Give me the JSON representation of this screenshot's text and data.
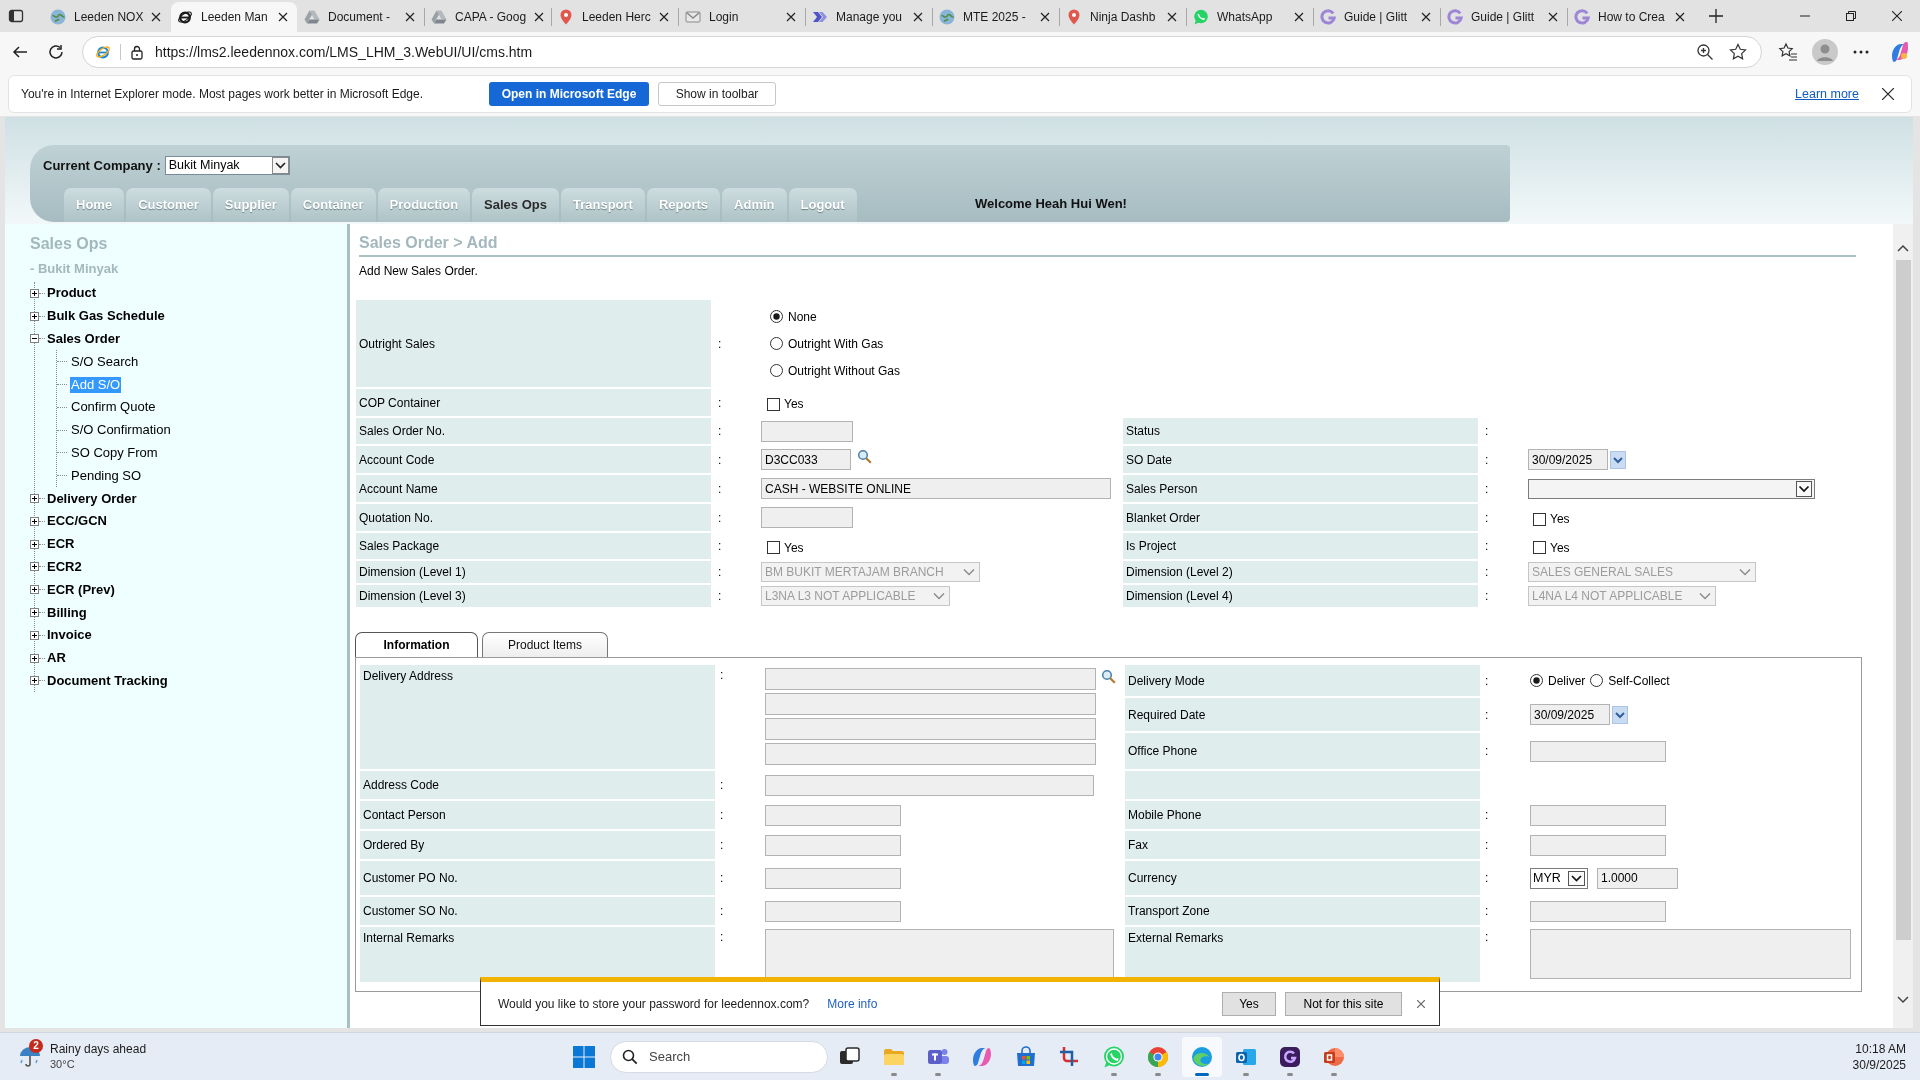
{
  "browser": {
    "tabs": [
      {
        "title": "Leeden NOX",
        "kind": "globe",
        "selected": false
      },
      {
        "title": "Leeden Man",
        "kind": "ie",
        "selected": true
      },
      {
        "title": "Document -",
        "kind": "drive",
        "selected": false
      },
      {
        "title": "CAPA - Goog",
        "kind": "drive",
        "selected": false
      },
      {
        "title": "Leeden Herc",
        "kind": "pin",
        "selected": false
      },
      {
        "title": "Login",
        "kind": "mail",
        "selected": false
      },
      {
        "title": "Manage you",
        "kind": "chevron",
        "selected": false
      },
      {
        "title": "MTE 2025 -",
        "kind": "globe",
        "selected": false
      },
      {
        "title": "Ninja Dashb",
        "kind": "pin",
        "selected": false
      },
      {
        "title": "WhatsApp",
        "kind": "chat",
        "selected": false
      },
      {
        "title": "Guide | Glitt",
        "kind": "g",
        "selected": false
      },
      {
        "title": "Guide | Glitt",
        "kind": "g",
        "selected": false
      },
      {
        "title": "How to Crea",
        "kind": "g",
        "selected": false
      }
    ],
    "address": "https://lms2.leedennox.com/LMS_LHM_3.WebUI/UI/cms.htm"
  },
  "ie_banner": {
    "message": "You're in Internet Explorer mode. Most pages work better in Microsoft Edge.",
    "primary_button": "Open in Microsoft Edge",
    "secondary_button": "Show in toolbar",
    "link": "Learn more"
  },
  "header": {
    "company_label": "Current Company :",
    "company": "Bukit Minyak",
    "nav": [
      {
        "label": "Home",
        "selected": false
      },
      {
        "label": "Customer",
        "selected": false
      },
      {
        "label": "Supplier",
        "selected": false
      },
      {
        "label": "Container",
        "selected": false
      },
      {
        "label": "Production",
        "selected": false
      },
      {
        "label": "Sales Ops",
        "selected": true
      },
      {
        "label": "Transport",
        "selected": false
      },
      {
        "label": "Reports",
        "selected": false
      },
      {
        "label": "Admin",
        "selected": false
      },
      {
        "label": "Logout",
        "selected": false
      }
    ],
    "welcome": "Welcome Heah Hui Wen!"
  },
  "sidebar": {
    "title": "Sales Ops",
    "subtitle": "- Bukit Minyak",
    "items": [
      {
        "label": "Product",
        "expanded": false
      },
      {
        "label": "Bulk Gas Schedule",
        "expanded": false
      },
      {
        "label": "Sales Order",
        "expanded": true,
        "children": [
          {
            "label": "S/O Search",
            "selected": false
          },
          {
            "label": "Add S/O",
            "selected": true
          },
          {
            "label": "Confirm Quote",
            "selected": false
          },
          {
            "label": "S/O Confirmation",
            "selected": false
          },
          {
            "label": "SO Copy From",
            "selected": false
          },
          {
            "label": "Pending SO",
            "selected": false
          }
        ]
      },
      {
        "label": "Delivery Order",
        "expanded": false
      },
      {
        "label": "ECC/GCN",
        "expanded": false
      },
      {
        "label": "ECR",
        "expanded": false
      },
      {
        "label": "ECR2",
        "expanded": false
      },
      {
        "label": "ECR (Prev)",
        "expanded": false
      },
      {
        "label": "Billing",
        "expanded": false
      },
      {
        "label": "Invoice",
        "expanded": false
      },
      {
        "label": "AR",
        "expanded": false
      },
      {
        "label": "Document Tracking",
        "expanded": false
      }
    ]
  },
  "form": {
    "title": "Sales Order > Add",
    "subtitle": "Add New Sales Order.",
    "rows": [
      {
        "left": {
          "label": "Outright Sales",
          "separator": ":",
          "kind": "radio",
          "options": [
            {
              "label": "None",
              "selected": true
            },
            {
              "label": "Outright With Gas",
              "selected": false
            },
            {
              "label": "Outright Without Gas",
              "selected": false
            }
          ]
        }
      },
      {
        "left": {
          "label": "COP Container",
          "separator": ":",
          "kind": "checkbox",
          "option": "Yes",
          "checked": false
        }
      },
      {
        "left": {
          "label": "Sales Order No.",
          "separator": ":",
          "kind": "text"
        },
        "right": {
          "label": "Status",
          "separator": ":",
          "kind": "none"
        }
      },
      {
        "left": {
          "label": "Account Code",
          "separator": ":",
          "kind": "lookup",
          "value": "D3CC033"
        },
        "right": {
          "label": "SO Date",
          "separator": ":",
          "kind": "date",
          "value": "30/09/2025"
        }
      },
      {
        "left": {
          "label": "Account Name",
          "separator": ":",
          "kind": "text",
          "value": "CASH - WEBSITE ONLINE"
        },
        "right": {
          "label": "Sales Person",
          "separator": ":",
          "kind": "select",
          "disabled": false
        }
      },
      {
        "left": {
          "label": "Quotation No.",
          "separator": ":",
          "kind": "text"
        },
        "right": {
          "label": "Blanket Order",
          "separator": ":",
          "kind": "checkbox",
          "option": "Yes",
          "checked": false
        }
      },
      {
        "left": {
          "label": "Sales Package",
          "separator": ":",
          "kind": "checkbox",
          "option": "Yes",
          "checked": false
        },
        "right": {
          "label": "Is Project",
          "separator": ":",
          "kind": "checkbox",
          "option": "Yes",
          "checked": false
        }
      },
      {
        "left": {
          "label": "Dimension (Level 1)",
          "separator": ":",
          "kind": "select",
          "value": "BM BUKIT MERTAJAM BRANCH",
          "disabled": true
        },
        "right": {
          "label": "Dimension (Level 2)",
          "separator": ":",
          "kind": "select",
          "value": "SALES GENERAL SALES",
          "disabled": true
        }
      },
      {
        "left": {
          "label": "Dimension (Level 3)",
          "separator": ":",
          "kind": "select",
          "value": "L3NA L3 NOT APPLICABLE",
          "disabled": true
        },
        "right": {
          "label": "Dimension (Level 4)",
          "separator": ":",
          "kind": "select",
          "value": "L4NA L4 NOT APPLICABLE",
          "disabled": true
        }
      }
    ]
  },
  "details": {
    "tabs": [
      {
        "label": "Information",
        "selected": true
      },
      {
        "label": "Product Items",
        "selected": false
      }
    ],
    "left": [
      {
        "label": "Delivery Address",
        "separator": ":",
        "kind": "address"
      },
      {
        "label": "Address Code",
        "separator": ":",
        "kind": "text"
      },
      {
        "label": "Contact Person",
        "separator": ":",
        "kind": "text"
      },
      {
        "label": "Ordered By",
        "separator": ":",
        "kind": "text"
      },
      {
        "label": "Customer PO No.",
        "separator": ":",
        "kind": "text"
      },
      {
        "label": "Customer SO No.",
        "separator": ":",
        "kind": "text"
      },
      {
        "label": "Internal Remarks",
        "separator": ":",
        "kind": "textarea"
      }
    ],
    "right": [
      {
        "label": "Delivery Mode",
        "separator": ":",
        "kind": "radio",
        "options": [
          {
            "label": "Deliver",
            "selected": true
          },
          {
            "label": "Self-Collect",
            "selected": false
          }
        ]
      },
      {
        "label": "Required Date",
        "separator": ":",
        "kind": "date",
        "value": "30/09/2025"
      },
      {
        "label": "Office Phone",
        "separator": ":",
        "kind": "text"
      },
      {
        "kind": "blank"
      },
      {
        "label": "Mobile Phone",
        "separator": ":",
        "kind": "text"
      },
      {
        "label": "Fax",
        "separator": ":",
        "kind": "text"
      },
      {
        "label": "Currency",
        "separator": ":",
        "kind": "currency",
        "currency": "MYR",
        "rate": "1.0000"
      },
      {
        "label": "Transport Zone",
        "separator": ":",
        "kind": "text"
      },
      {
        "label": "External Remarks",
        "separator": ":",
        "kind": "textarea"
      }
    ]
  },
  "password_prompt": {
    "message": "Would you like to store your password for leedennox.com?",
    "link": "More info",
    "buttons": [
      "Yes",
      "Not for this site"
    ]
  },
  "taskbar": {
    "weather": {
      "badge": "2",
      "title": "Rainy days ahead",
      "temperature": "30°C"
    },
    "search": {
      "placeholder": "Search"
    },
    "apps": [
      {
        "kind": "taskview",
        "running": false,
        "active": false
      },
      {
        "kind": "explorer",
        "running": true,
        "active": false
      },
      {
        "kind": "teams",
        "running": true,
        "active": false
      },
      {
        "kind": "copilot",
        "running": false,
        "active": false
      },
      {
        "kind": "store",
        "running": false,
        "active": false
      },
      {
        "kind": "snip",
        "running": false,
        "active": false
      },
      {
        "kind": "whatsapp",
        "running": true,
        "active": false
      },
      {
        "kind": "chrome",
        "running": true,
        "active": false
      },
      {
        "kind": "edge",
        "running": true,
        "active": true
      },
      {
        "kind": "outlook",
        "running": true,
        "active": false
      },
      {
        "kind": "gapp",
        "running": true,
        "active": false
      },
      {
        "kind": "powerpoint",
        "running": true,
        "active": false
      }
    ],
    "time": "10:18 AM",
    "date": "30/9/2025"
  }
}
